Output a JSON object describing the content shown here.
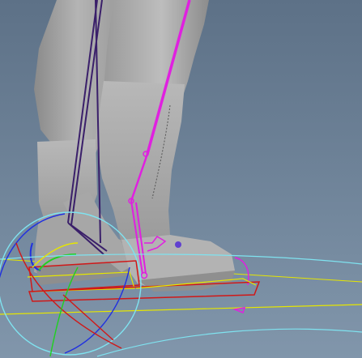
{
  "viewport": {
    "background_top": "#5f7389",
    "background_bottom": "#7f93a8",
    "colors": {
      "model_gray": "#a9a9a9",
      "model_shadow": "#8a8a8a",
      "selected_bone": "#e020e0",
      "bone_dark": "#3a1f6a",
      "ik_yellow": "#e6e600",
      "control_cyan": "#7fe3f0",
      "axis_red": "#d01818",
      "axis_green": "#20d020",
      "axis_blue": "#2030e0"
    }
  }
}
